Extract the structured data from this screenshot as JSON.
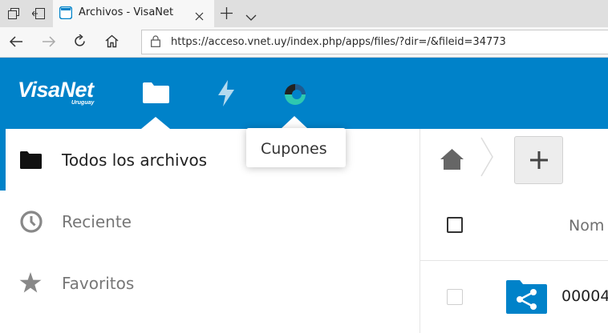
{
  "browser": {
    "tab_title": "Archivos - VisaNet",
    "url": "https://acceso.vnet.uy/index.php/apps/files/?dir=/&fileid=34773"
  },
  "header": {
    "logo_text": "VisaNet",
    "logo_subtext": "Uruguay",
    "apps": [
      {
        "name": "Archivos",
        "icon": "folder-icon",
        "active": true
      },
      {
        "name": "Activity",
        "icon": "lightning-icon",
        "active": false
      },
      {
        "name": "Cupones",
        "icon": "cupones-app-icon",
        "active": false
      }
    ],
    "tooltip": "Cupones",
    "accent_color": "#0082c9"
  },
  "sidebar": {
    "items": [
      {
        "label": "Todos los archivos",
        "icon": "folder-icon",
        "active": true
      },
      {
        "label": "Reciente",
        "icon": "clock-icon",
        "active": false
      },
      {
        "label": "Favoritos",
        "icon": "star-icon",
        "active": false
      }
    ]
  },
  "files": {
    "column_name": "Nom",
    "rows": [
      {
        "name": "00004",
        "icon": "shared-folder-icon"
      }
    ]
  }
}
